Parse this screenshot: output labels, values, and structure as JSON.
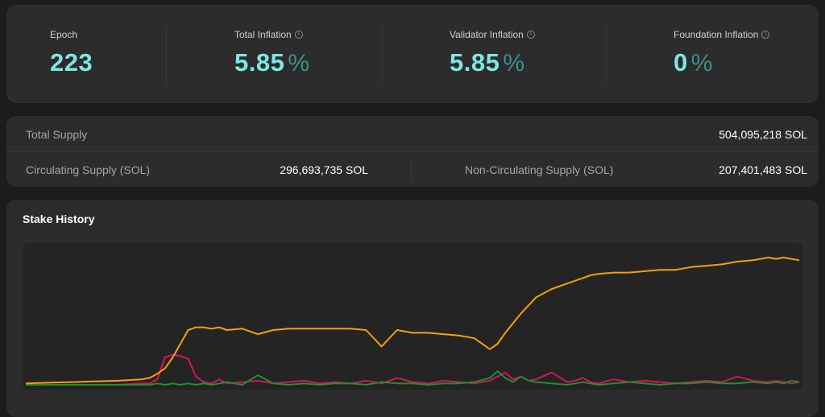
{
  "stats": {
    "epoch": {
      "label": "Epoch",
      "value": "223"
    },
    "total_inflation": {
      "label": "Total Inflation",
      "value": "5.85",
      "unit": "%"
    },
    "validator_inflation": {
      "label": "Validator Inflation",
      "value": "5.85",
      "unit": "%"
    },
    "foundation_inflation": {
      "label": "Foundation Inflation",
      "value": "0",
      "unit": "%"
    },
    "info_glyph": "i"
  },
  "supply": {
    "total_label": "Total Supply",
    "total_value": "504,095,218 SOL",
    "circulating_label": "Circulating Supply (SOL)",
    "circulating_value": "296,693,735 SOL",
    "non_circulating_label": "Non-Circulating Supply (SOL)",
    "non_circulating_value": "207,401,483 SOL"
  },
  "stake_history": {
    "title": "Stake History"
  },
  "colors": {
    "accent_teal": "#7ee7e2",
    "series_orange": "#f5a00a",
    "series_magenta": "#d4145a",
    "series_green": "#1f8f2c"
  },
  "chart_data": {
    "type": "line",
    "ylim": [
      0,
      100
    ],
    "x": [
      0,
      3,
      6,
      9,
      12,
      15,
      16,
      17,
      18,
      19,
      20,
      21,
      22,
      23,
      24,
      25,
      26,
      28,
      30,
      32,
      34,
      36,
      38,
      40,
      42,
      44,
      46,
      48,
      50,
      52,
      54,
      56,
      58,
      60,
      61,
      62,
      63,
      64,
      65,
      66,
      68,
      70,
      71,
      72,
      73,
      74,
      76,
      78,
      80,
      82,
      84,
      86,
      88,
      90,
      92,
      94,
      96,
      97,
      98,
      99,
      100
    ],
    "series": [
      {
        "color": "#f5a00a",
        "values": [
          1,
          1.5,
          2,
          2.5,
          3,
          4,
          5,
          8,
          12,
          20,
          30,
          40,
          42,
          42,
          41,
          42,
          40,
          41,
          37,
          40,
          41,
          41,
          41,
          41,
          41,
          40,
          28,
          40,
          38,
          38,
          37,
          36,
          34,
          26,
          30,
          38,
          45,
          52,
          58,
          64,
          70,
          74,
          76,
          78,
          80,
          81,
          82,
          82,
          83,
          84,
          84,
          86,
          87,
          88,
          90,
          91,
          93,
          92,
          93,
          92,
          91
        ]
      },
      {
        "color": "#d4145a",
        "values": [
          0,
          0,
          0,
          0,
          0,
          1,
          1,
          4,
          20,
          22,
          21,
          19,
          6,
          2,
          1,
          4,
          1,
          2,
          3,
          1,
          2,
          3,
          1,
          2,
          1,
          3,
          1,
          5,
          2,
          1,
          3,
          2,
          1,
          3,
          6,
          9,
          4,
          6,
          3,
          4,
          9,
          2,
          3,
          5,
          2,
          1,
          4,
          2,
          3,
          2,
          1,
          2,
          3,
          2,
          6,
          3,
          2,
          3,
          2,
          1,
          2
        ]
      },
      {
        "color": "#1f8f2c",
        "values": [
          0,
          0,
          0,
          0,
          0,
          0,
          0,
          1,
          0,
          1,
          0,
          1,
          0,
          1,
          0,
          1,
          2,
          0,
          7,
          1,
          0,
          1,
          0,
          1,
          1,
          0,
          2,
          1,
          1,
          0,
          1,
          1,
          2,
          5,
          10,
          5,
          2,
          6,
          3,
          2,
          1,
          0,
          1,
          2,
          1,
          0,
          1,
          2,
          1,
          0,
          1,
          1,
          2,
          1,
          1,
          2,
          1,
          2,
          1,
          3,
          2
        ]
      }
    ],
    "grid": false,
    "legend": "none"
  }
}
